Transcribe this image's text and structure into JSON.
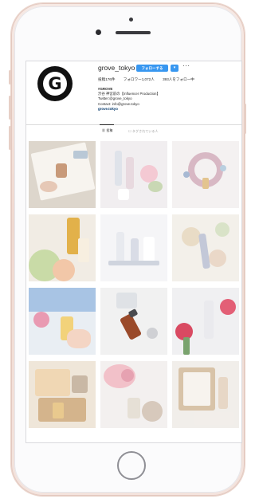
{
  "profile": {
    "username": "grove_tokyo",
    "avatar_letter": "G",
    "buttons": {
      "follow": "フォローする",
      "dropdown": "▾",
      "more": "···"
    },
    "stats": {
      "posts": "投稿176件",
      "followers": "フォロワー1,072人",
      "following": "393人をフォロー中"
    },
    "bio": [
      "#GROVE",
      "渋谷 神宮前の【Influencer Production】",
      "Twitter:@grove_tokyo",
      "Contact: info@grove.tokyo"
    ],
    "website": "grove.tokyo"
  },
  "tabs": {
    "posts": "▦ 投稿",
    "tagged": "☐ タグされている人"
  },
  "posts": [
    {
      "label": "tray-post",
      "bg": "#ddd6cc"
    },
    {
      "label": "bottles-flowers-post",
      "bg": "#f1eef0"
    },
    {
      "label": "heart-petals-post",
      "bg": "#f4f1f1"
    },
    {
      "label": "gold-perfume-post",
      "bg": "#f1ece4"
    },
    {
      "label": "white-bottles-post",
      "bg": "#f5f5f7"
    },
    {
      "label": "pastel-circles-post",
      "bg": "#f3f0ea"
    },
    {
      "label": "hand-perfume-post",
      "bg": "#e9eef3"
    },
    {
      "label": "amber-bottle-post",
      "bg": "#f1f1f1"
    },
    {
      "label": "rose-bottle-post",
      "bg": "#f0f0f2"
    },
    {
      "label": "gift-box-post",
      "bg": "#efe6d9"
    },
    {
      "label": "pink-flowers-post",
      "bg": "#f3f0ef"
    },
    {
      "label": "mirror-frame-post",
      "bg": "#f1eeea"
    }
  ],
  "device": {
    "frame_color": "#efd9d0",
    "accent": "#3897f0"
  }
}
